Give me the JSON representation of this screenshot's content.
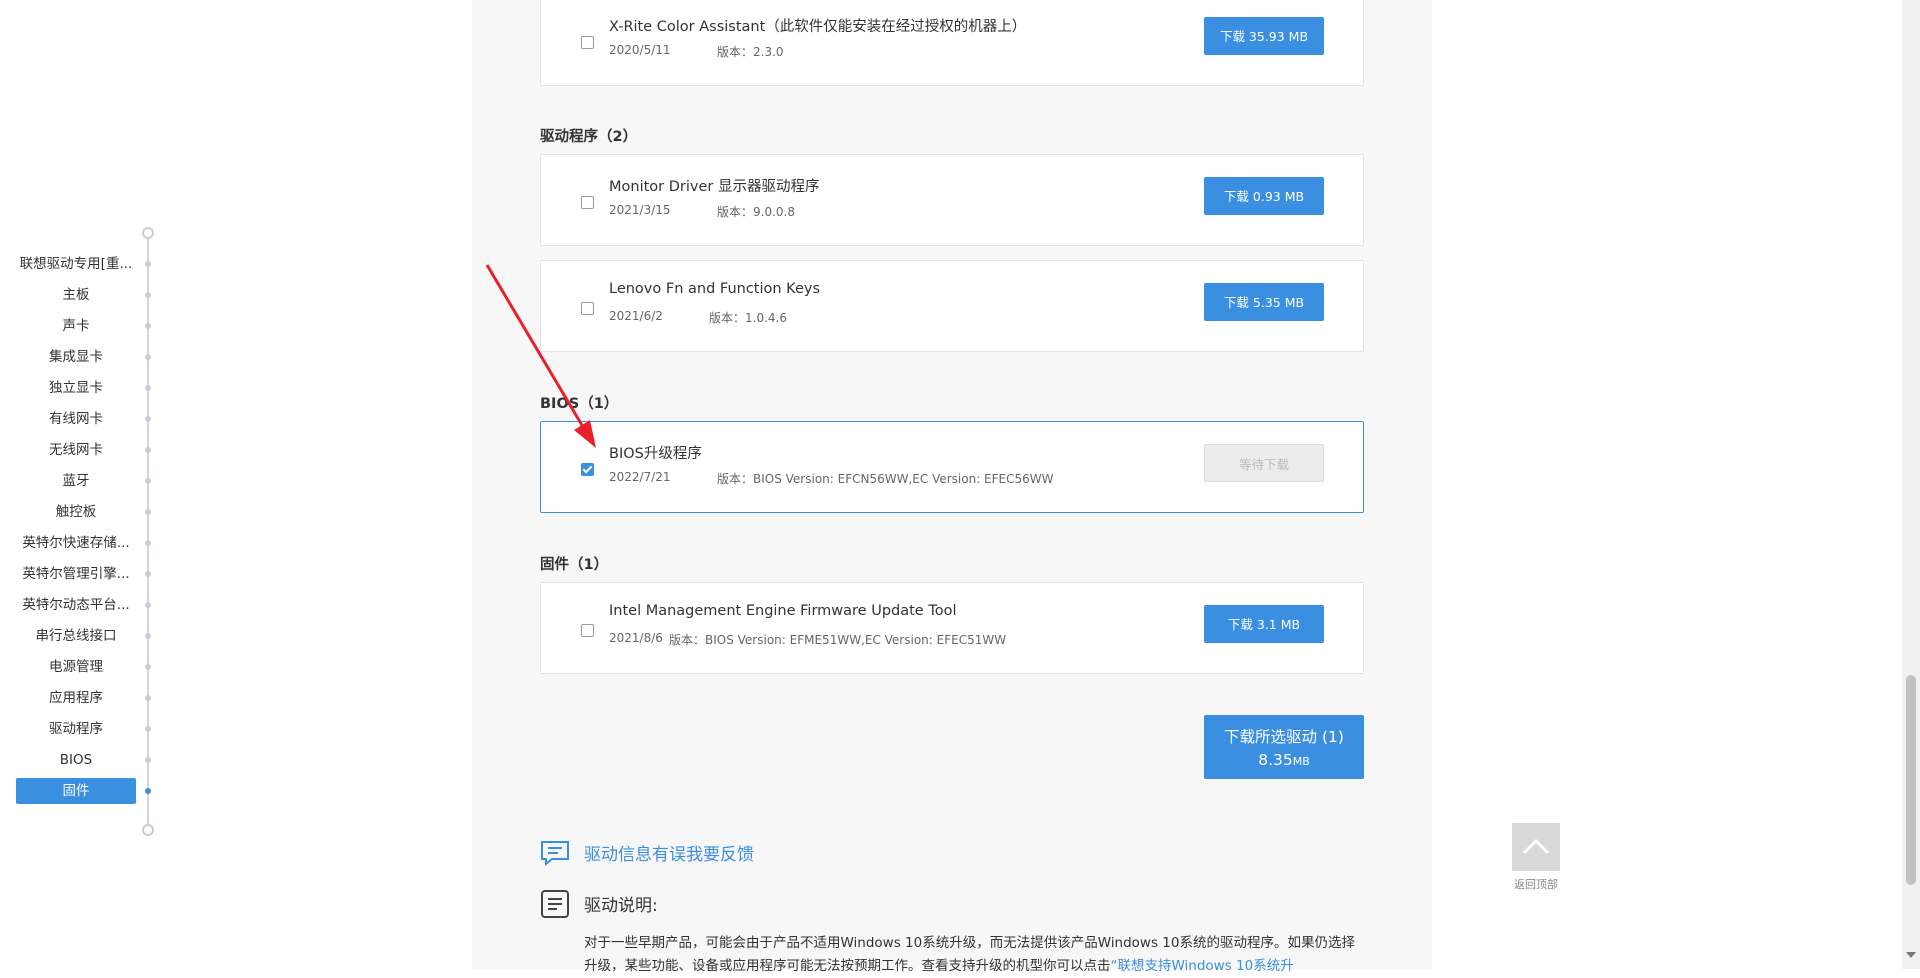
{
  "nav": {
    "items": [
      {
        "label": "联想驱动专用[重..."
      },
      {
        "label": "主板"
      },
      {
        "label": "声卡"
      },
      {
        "label": "集成显卡"
      },
      {
        "label": "独立显卡"
      },
      {
        "label": "有线网卡"
      },
      {
        "label": "无线网卡"
      },
      {
        "label": "蓝牙"
      },
      {
        "label": "触控板"
      },
      {
        "label": "英特尔快速存储..."
      },
      {
        "label": "英特尔管理引擎..."
      },
      {
        "label": "英特尔动态平台..."
      },
      {
        "label": "串行总线接口"
      },
      {
        "label": "电源管理"
      },
      {
        "label": "应用程序"
      },
      {
        "label": "驱动程序"
      },
      {
        "label": "BIOS"
      },
      {
        "label": "固件"
      }
    ],
    "active_index": 17
  },
  "sections": {
    "top_card": {
      "name": "X-Rite Color Assistant（此软件仅能安装在经过授权的机器上）",
      "date": "2020/5/11",
      "version": "版本：2.3.0",
      "button": "下载 35.93 MB"
    },
    "drivers": {
      "title": "驱动程序（2）",
      "cards": [
        {
          "name": "Monitor Driver 显示器驱动程序",
          "date": "2021/3/15",
          "version": "版本：9.0.0.8",
          "button": "下载 0.93 MB"
        },
        {
          "name": "Lenovo Fn and Function Keys",
          "date": "2021/6/2",
          "version": "版本：1.0.4.6",
          "button": "下载 5.35 MB"
        }
      ]
    },
    "bios": {
      "title": "BIOS（1）",
      "cards": [
        {
          "name": "BIOS升级程序",
          "date": "2022/7/21",
          "version": "版本：BIOS Version: EFCN56WW,EC Version: EFEC56WW",
          "button": "等待下载",
          "checked": true
        }
      ]
    },
    "firmware": {
      "title": "固件（1）",
      "cards": [
        {
          "name": "Intel Management Engine Firmware Update Tool",
          "date": "2021/8/6",
          "version": "版本：BIOS Version: EFME51WW,EC Version: EFEC51WW",
          "button": "下载 3.1 MB"
        }
      ]
    }
  },
  "download_all": {
    "line1": "下载所选驱动 (1)",
    "size": "8.35",
    "unit": "MB"
  },
  "feedback_label": "驱动信息有误我要反馈",
  "description": {
    "title": "驱动说明:",
    "text": "对于一些早期产品，可能会由于产品不适用Windows 10系统升级，而无法提供该产品Windows 10系统的驱动程序。如果仍选择升级，某些功能、设备或应用程序可能无法按预期工作。查看支持升级的机型你可以点击",
    "link": "“联想支持Windows 10系统升"
  },
  "to_top_label": "返回顶部",
  "colors": {
    "accent": "#3b8fe0",
    "annotation": "#e8202a"
  }
}
